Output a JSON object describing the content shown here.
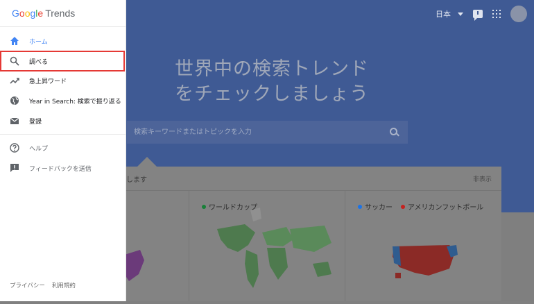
{
  "topbar": {
    "language": "日本"
  },
  "hero": {
    "title": "世界中の検索トレンド\nをチェックしましょう"
  },
  "search": {
    "placeholder": "検索キーワードまたはトピックを入力"
  },
  "card": {
    "title_fragment": "します",
    "hide_label": "非表示",
    "columns": [
      {
        "legend": []
      },
      {
        "legend": [
          {
            "label": "ワールドカップ",
            "color": "#188038"
          }
        ]
      },
      {
        "legend": [
          {
            "label": "サッカー",
            "color": "#1a73e8"
          },
          {
            "label": "アメリカンフットボール",
            "color": "#c5221f"
          }
        ]
      }
    ]
  },
  "sidebar": {
    "logo": {
      "google": "Google",
      "trends": "Trends"
    },
    "items": [
      {
        "label": "ホーム",
        "icon": "home-icon",
        "active": true
      },
      {
        "label": "調べる",
        "icon": "search-icon"
      },
      {
        "label": "急上昇ワード",
        "icon": "trending-up-icon"
      },
      {
        "label": "Year in Search: 検索で振り返る",
        "icon": "globe-icon"
      },
      {
        "label": "登録",
        "icon": "mail-icon"
      },
      {
        "label": "ヘルプ",
        "icon": "help-icon"
      },
      {
        "label": "フィードバックを送信",
        "icon": "feedback-icon"
      }
    ],
    "footer": {
      "privacy": "プライバシー",
      "terms": "利用規約"
    }
  },
  "colors": {
    "accent": "#4285f4",
    "highlight": "#e53935",
    "hero": "#4a66a8"
  }
}
